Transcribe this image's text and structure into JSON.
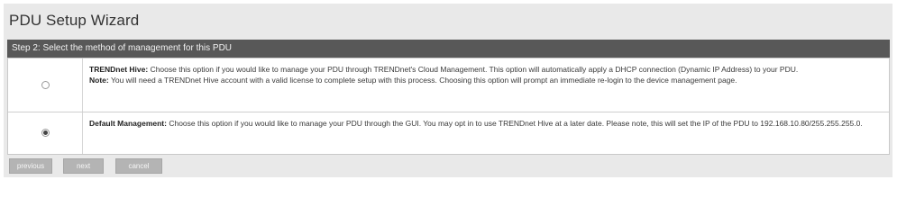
{
  "wizard": {
    "title": "PDU Setup Wizard",
    "step_header": "Step 2: Select the method of management for this PDU"
  },
  "options": [
    {
      "title": "TRENDnet Hive:",
      "description": "Choose this option if you would like to manage your PDU through TRENDnet's Cloud Management. This option will automatically apply a DHCP connection (Dynamic IP Address) to your PDU.",
      "note_label": "Note:",
      "note": "You will need a TRENDnet Hive account with a valid license to complete setup with this process. Choosing this option will prompt an immediate re-login to the device management page.",
      "selected": false
    },
    {
      "title": "Default Management:",
      "description": "Choose this option if you would like to manage your PDU through the GUI. You may opt in to use TRENDnet Hive at a later date. Please note, this will set the IP of the PDU to 192.168.10.80/255.255.255.0.",
      "selected": true
    }
  ],
  "buttons": {
    "previous": "previous",
    "next": "next",
    "cancel": "cancel"
  }
}
